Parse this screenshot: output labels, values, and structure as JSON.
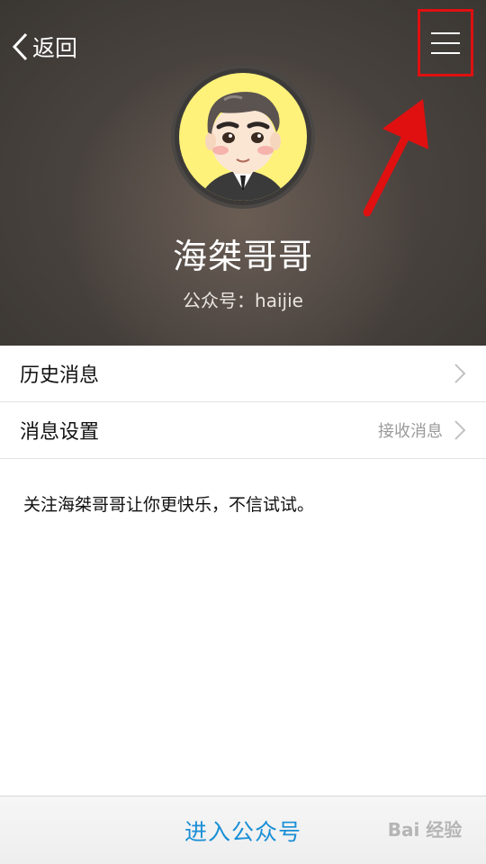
{
  "header": {
    "back_label": "返回",
    "profile_name": "海桀哥哥",
    "profile_id": "公众号：haijie"
  },
  "list": {
    "items": [
      {
        "label": "历史消息",
        "value": ""
      },
      {
        "label": "消息设置",
        "value": "接收消息"
      }
    ]
  },
  "description": "关注海桀哥哥让你更快乐，不信试试。",
  "bottom": {
    "enter_label": "进入公众号"
  },
  "watermark": "Bai 经验",
  "icons": [
    "chevron-left-icon",
    "menu-icon",
    "chevron-right-icon",
    "red-arrow-annotation"
  ],
  "colors": {
    "accent": "#1a8fd6",
    "annotation": "#e01010",
    "avatar_bg": "#fff27a"
  }
}
